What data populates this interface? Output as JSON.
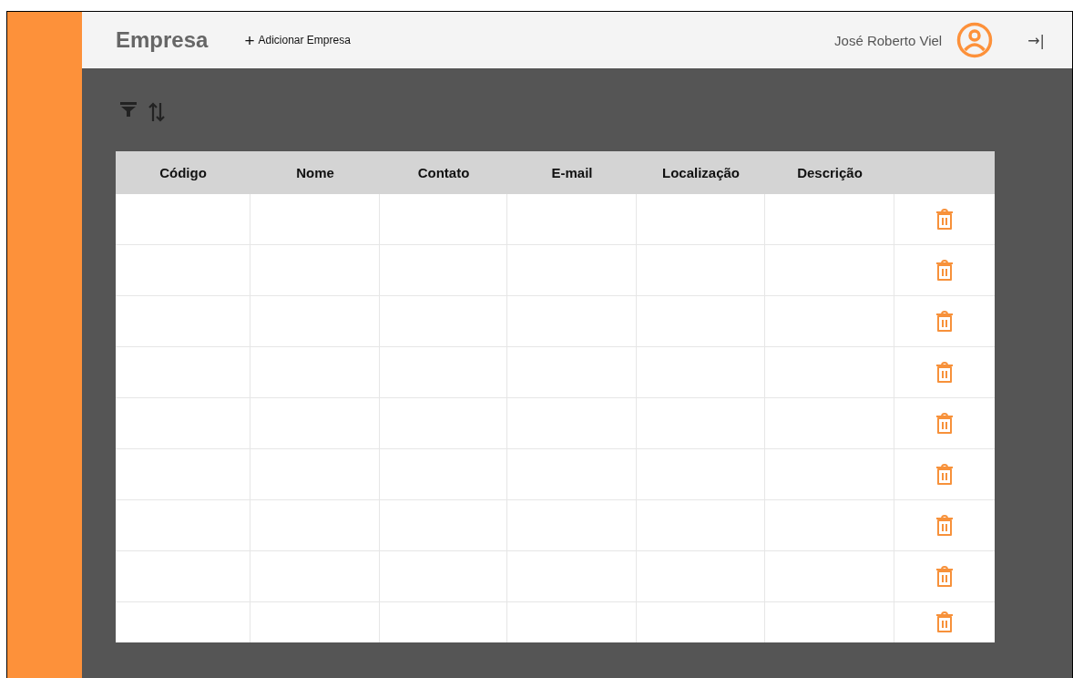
{
  "header": {
    "title": "Empresa",
    "add_button": {
      "icon": "+",
      "label": "Adicionar Empresa"
    },
    "user_name": "José Roberto Viel",
    "exit_icon": "→|"
  },
  "toolbar": {
    "icons": [
      {
        "kind": "filter"
      },
      {
        "kind": "sort"
      }
    ]
  },
  "table": {
    "columns": [
      "Código",
      "Nome",
      "Contato",
      "E-mail",
      "Localização",
      "Descrição"
    ],
    "rows": [
      {
        "kind": "blank"
      },
      {
        "kind": "blank"
      },
      {
        "kind": "blank"
      },
      {
        "kind": "blank"
      },
      {
        "kind": "blank"
      },
      {
        "kind": "blank"
      },
      {
        "kind": "blank"
      },
      {
        "kind": "blank"
      },
      {
        "kind": "blank"
      }
    ]
  }
}
